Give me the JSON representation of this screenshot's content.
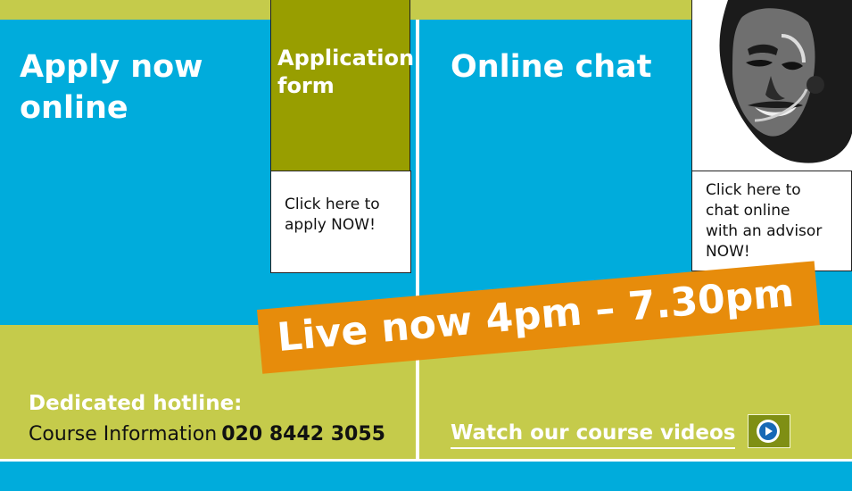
{
  "apply": {
    "heading_line1": "Apply now",
    "heading_line2": "online",
    "form_label_line1": "Application",
    "form_label_line2": "form",
    "card_line1": "Click here to",
    "card_line2": "apply NOW!"
  },
  "chat": {
    "heading": "Online chat",
    "card_line1": "Click here to",
    "card_line2": "chat online",
    "card_line3": "with an advisor",
    "card_line4": "NOW!"
  },
  "banner": {
    "text": "Live now 4pm – 7.30pm"
  },
  "hotline": {
    "title": "Dedicated hotline:",
    "label": "Course Information",
    "number": "020 8442 3055"
  },
  "videos": {
    "link_text": "Watch our course videos"
  },
  "icons": {
    "play": "play-icon",
    "advisor": "advisor-headset-photo"
  },
  "colors": {
    "blue": "#00acdc",
    "lime": "#c5cb4b",
    "olive": "#989e00",
    "orange": "#e78c0b",
    "button_green": "#7f8f14"
  }
}
